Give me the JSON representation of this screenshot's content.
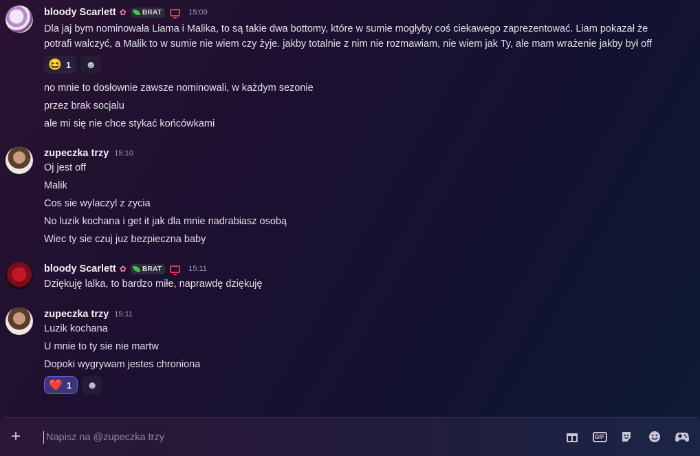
{
  "messages": [
    {
      "author": "bloody Scarlett",
      "badge": "BRAT",
      "time": "15:09",
      "lines": [
        "Dla jaj bym nominowała Liama i Malika, to są takie dwa bottomy, które w sumie mogłyby coś ciekawego zaprezentować. Liam pokazał że",
        "potrafi walczyć, a Malik to w sumie nie wiem czy żyje. jakby totalnie z nim nie rozmawiam, nie wiem jak Ty, ale mam wrażenie jakby był off"
      ],
      "reaction": {
        "emoji": "😆",
        "count": "1"
      },
      "followups": [
        "no mnie to dosłownie zawsze nominowali, w każdym sezonie",
        "przez brak socjalu",
        "ale mi się nie chce stykać końcówkami"
      ]
    },
    {
      "author": "zupeczka trzy",
      "time": "15:10",
      "lines": [
        "Oj jest off",
        "Malik",
        "Cos sie wylaczyl z zycia",
        "No luzik kochana i get it jak dla mnie nadrabiasz osobą",
        "Wiec ty sie czuj juz bezpieczna baby"
      ]
    },
    {
      "author": "bloody Scarlett",
      "badge": "BRAT",
      "time": "15:11",
      "lines": [
        "Dziękuję lalka, to bardzo miłe, naprawdę dziękuję"
      ]
    },
    {
      "author": "zupeczka trzy",
      "time": "15:11",
      "lines": [
        "Luzik kochana",
        "U mnie to ty sie nie martw",
        "Dopoki wygrywam jestes chroniona"
      ],
      "reaction": {
        "emoji": "❤️",
        "count": "1"
      }
    }
  ],
  "composer": {
    "placeholder": "Napisz na @zupeczka trzy",
    "gif_label": "GIF"
  },
  "icons": {
    "flower": "flower-icon",
    "leaf": "leaf-icon",
    "monitor": "monitor-icon",
    "gift": "gift-icon",
    "sticker": "sticker-icon",
    "emoji": "emoji-icon",
    "gamepad": "gamepad-icon"
  },
  "colors": {
    "accent": "#6a5fe0",
    "monitor_red": "#e03a4b",
    "leaf_green": "#41c24d"
  }
}
